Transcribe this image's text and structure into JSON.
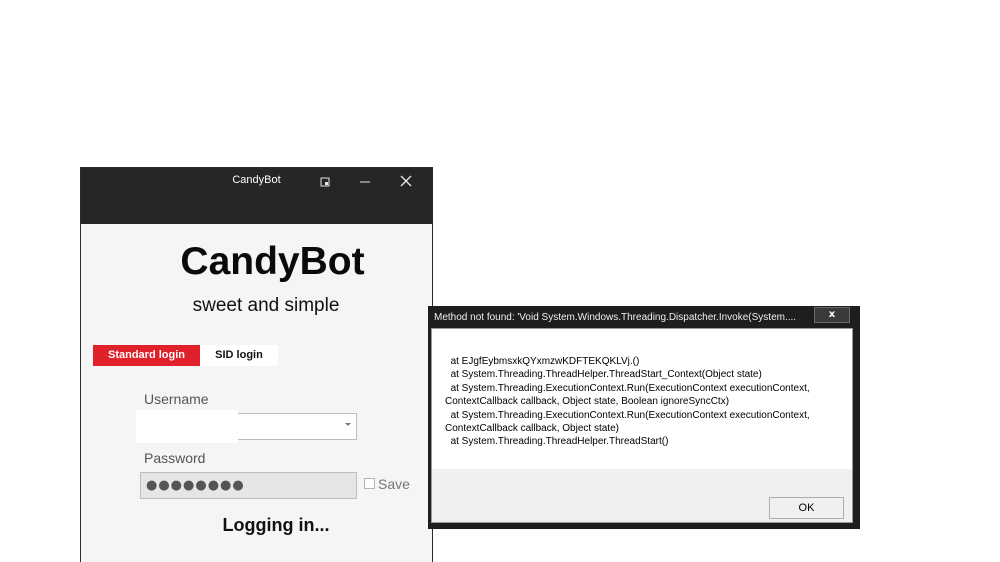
{
  "candybot_window": {
    "title": "CandyBot",
    "brand": "CandyBot",
    "tagline": "sweet and simple",
    "tabs": [
      {
        "label": "Standard login",
        "active": true
      },
      {
        "label": "SID login",
        "active": false
      }
    ],
    "username": {
      "label": "Username",
      "value": ""
    },
    "password": {
      "label": "Password",
      "value": "●●●●●●●●"
    },
    "save": {
      "label": "Save",
      "checked": false
    },
    "status": "Logging in...",
    "colors": {
      "titlebar": "#262626",
      "accent": "#e0202b"
    },
    "controls": [
      "restore-icon",
      "minimize-icon",
      "close-icon"
    ]
  },
  "error_dialog": {
    "title": "Method not found: 'Void System.Windows.Threading.Dispatcher.Invoke(System....",
    "close_label": "x",
    "message_lines": [
      "  at EJgfEybmsxkQYxmzwKDFTEKQKLVj.()",
      "  at System.Threading.ThreadHelper.ThreadStart_Context(Object state)",
      "  at System.Threading.ExecutionContext.Run(ExecutionContext executionContext,",
      "ContextCallback callback, Object state, Boolean ignoreSyncCtx)",
      "  at System.Threading.ExecutionContext.Run(ExecutionContext executionContext,",
      "ContextCallback callback, Object state)",
      "  at System.Threading.ThreadHelper.ThreadStart()"
    ],
    "ok_label": "OK"
  }
}
